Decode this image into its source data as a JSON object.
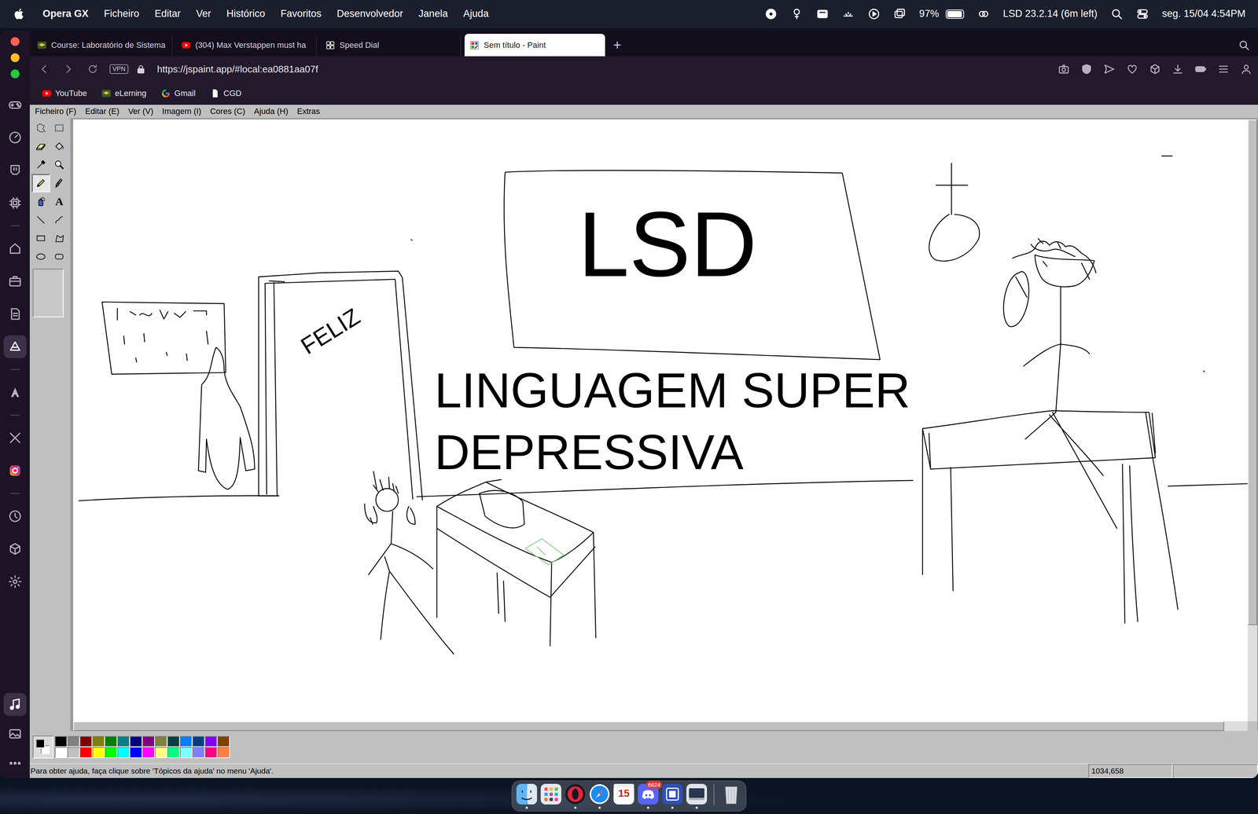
{
  "menubar": {
    "app": "Opera GX",
    "items": [
      "Ficheiro",
      "Editar",
      "Ver",
      "Histórico",
      "Favoritos",
      "Desenvolvedor",
      "Janela",
      "Ajuda"
    ],
    "battery": {
      "reading": "97%",
      "level": 0.97
    },
    "status": "LSD 23.2.14 (6m left)",
    "clock": "seg. 15/04 4:54PM"
  },
  "sidebar": {
    "top": [
      {
        "kind": "gamepad",
        "selected": false
      },
      {
        "kind": "gauge",
        "selected": false
      },
      {
        "kind": "bag",
        "selected": false
      },
      {
        "kind": "cpu",
        "selected": false
      },
      {
        "kind": "separator"
      },
      {
        "kind": "home",
        "selected": false
      },
      {
        "kind": "briefcase",
        "selected": false
      },
      {
        "kind": "document",
        "selected": false
      },
      {
        "kind": "aria",
        "selected": true
      },
      {
        "kind": "separator"
      },
      {
        "kind": "aria-a",
        "selected": false
      },
      {
        "kind": "separator"
      },
      {
        "kind": "x",
        "selected": false
      },
      {
        "kind": "instagram",
        "selected": false
      },
      {
        "kind": "separator"
      },
      {
        "kind": "clock",
        "selected": false
      },
      {
        "kind": "cube",
        "selected": false
      },
      {
        "kind": "gear",
        "selected": false
      }
    ],
    "bottom": [
      {
        "kind": "music",
        "selected": true
      },
      {
        "kind": "image",
        "selected": false
      },
      {
        "kind": "more",
        "selected": false
      }
    ]
  },
  "tabs": [
    {
      "label": "Course: Laboratório de Sistema",
      "kind": "elearning",
      "selected": false
    },
    {
      "label": "(304) Max Verstappen must ha",
      "kind": "youtube",
      "selected": false
    },
    {
      "label": "Speed Dial",
      "kind": "speed-dial",
      "selected": false
    },
    {
      "label": "Sem título - Paint",
      "kind": "paint",
      "selected": true
    }
  ],
  "new_tab": "+",
  "address": {
    "vpn": "VPN",
    "url": "https://jspaint.app/#local:ea0881aa07f"
  },
  "bookmarks": [
    {
      "label": "YouTube",
      "kind": "youtube"
    },
    {
      "label": "eLerning",
      "kind": "elearning"
    },
    {
      "label": "Gmail",
      "kind": "google"
    },
    {
      "label": "CGD",
      "kind": "document"
    }
  ],
  "paint": {
    "menus": [
      "Ficheiro (F)",
      "Editar (E)",
      "Ver (V)",
      "Imagem (I)",
      "Cores (C)",
      "Ajuda (H)",
      "Extras"
    ],
    "tools": [
      {
        "kind": "free-select",
        "selected": false
      },
      {
        "kind": "select",
        "selected": false
      },
      {
        "kind": "eraser",
        "selected": false
      },
      {
        "kind": "fill",
        "selected": false
      },
      {
        "kind": "pick-color",
        "selected": false
      },
      {
        "kind": "magnifier",
        "selected": false
      },
      {
        "kind": "pencil",
        "selected": true
      },
      {
        "kind": "brush",
        "selected": false
      },
      {
        "kind": "airbrush",
        "selected": false
      },
      {
        "kind": "text",
        "glyph": "A",
        "selected": false
      },
      {
        "kind": "line",
        "selected": false
      },
      {
        "kind": "curve",
        "selected": false
      },
      {
        "kind": "rectangle",
        "selected": false
      },
      {
        "kind": "polygon",
        "selected": false
      },
      {
        "kind": "ellipse",
        "selected": false
      },
      {
        "kind": "rounded-rectangle",
        "selected": false
      }
    ],
    "colors": {
      "foreground": "#000000",
      "background": "#ffffff"
    },
    "palette": [
      {
        "color": "#000000"
      },
      {
        "color": "#808080"
      },
      {
        "color": "#800000"
      },
      {
        "color": "#808000"
      },
      {
        "color": "#008000"
      },
      {
        "color": "#008080"
      },
      {
        "color": "#000080"
      },
      {
        "color": "#800080"
      },
      {
        "color": "#808040"
      },
      {
        "color": "#004040"
      },
      {
        "color": "#0080ff"
      },
      {
        "color": "#004080"
      },
      {
        "color": "#8000ff"
      },
      {
        "color": "#804000"
      },
      {
        "color": "#ffffff"
      },
      {
        "color": "#c0c0c0"
      },
      {
        "color": "#ff0000"
      },
      {
        "color": "#ffff00"
      },
      {
        "color": "#00ff00"
      },
      {
        "color": "#00ffff"
      },
      {
        "color": "#0000ff"
      },
      {
        "color": "#ff00ff"
      },
      {
        "color": "#ffff80"
      },
      {
        "color": "#00ff80"
      },
      {
        "color": "#80ffff"
      },
      {
        "color": "#8080ff"
      },
      {
        "color": "#ff0080"
      },
      {
        "color": "#ff8040"
      }
    ],
    "canvas": {
      "board": "LSD",
      "door_sign": "FELIZ",
      "caption": [
        "LINGUAGEM SUPER",
        "DEPRESSIVA"
      ]
    },
    "scrollbars": {
      "vertical": {
        "level": 0.84
      },
      "horizontal": {
        "level": 0.98
      }
    },
    "status_bar": {
      "help": "Para obter ajuda, faça clique sobre 'Tópicos da ajuda' no menu 'Ajuda'.",
      "coordinates": "1034,658"
    }
  },
  "dock": {
    "items": [
      {
        "kind": "finder",
        "running": true
      },
      {
        "kind": "launchpad",
        "running": false
      },
      {
        "kind": "opera",
        "running": true
      },
      {
        "kind": "safari",
        "running": true
      },
      {
        "kind": "calendar",
        "running": false,
        "label": "15"
      },
      {
        "kind": "discord",
        "running": true,
        "badge": "6624"
      },
      {
        "kind": "app-blue",
        "running": true
      },
      {
        "kind": "app-screen",
        "running": true
      },
      {
        "kind": "trash",
        "running": false
      }
    ]
  }
}
